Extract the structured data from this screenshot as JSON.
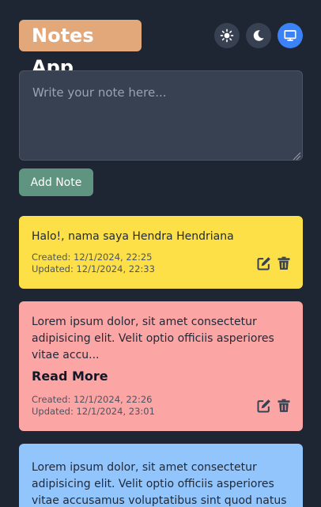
{
  "app": {
    "title": "Notes App"
  },
  "theme": {
    "options": [
      {
        "name": "light",
        "icon": "sun-icon"
      },
      {
        "name": "dark",
        "icon": "moon-icon"
      },
      {
        "name": "system",
        "icon": "monitor-icon"
      }
    ],
    "selected": "system",
    "colors": {
      "inactive": "#374151",
      "active": "#3b82f6"
    }
  },
  "editor": {
    "placeholder": "Write your note here...",
    "value": "",
    "add_label": "Add Note"
  },
  "notes": [
    {
      "content": "Halo!, nama saya Hendra Hendriana",
      "created": "Created: 12/1/2024, 22:25",
      "updated": "Updated: 12/1/2024, 22:33",
      "color": "#fde047"
    },
    {
      "content": "Lorem ipsum dolor, sit amet consectetur adipisicing elit. Velit optio officiis asperiores vitae accu...",
      "read_more": "Read More",
      "created": "Created: 12/1/2024, 22:26",
      "updated": "Updated: 12/1/2024, 23:01",
      "color": "#fca5a5"
    },
    {
      "content": "Lorem ipsum dolor, sit amet consectetur adipisicing elit. Velit optio officiis asperiores vitae accusamus voluptatibus sint quod natus quaerat",
      "color": "#93c5fd"
    }
  ]
}
